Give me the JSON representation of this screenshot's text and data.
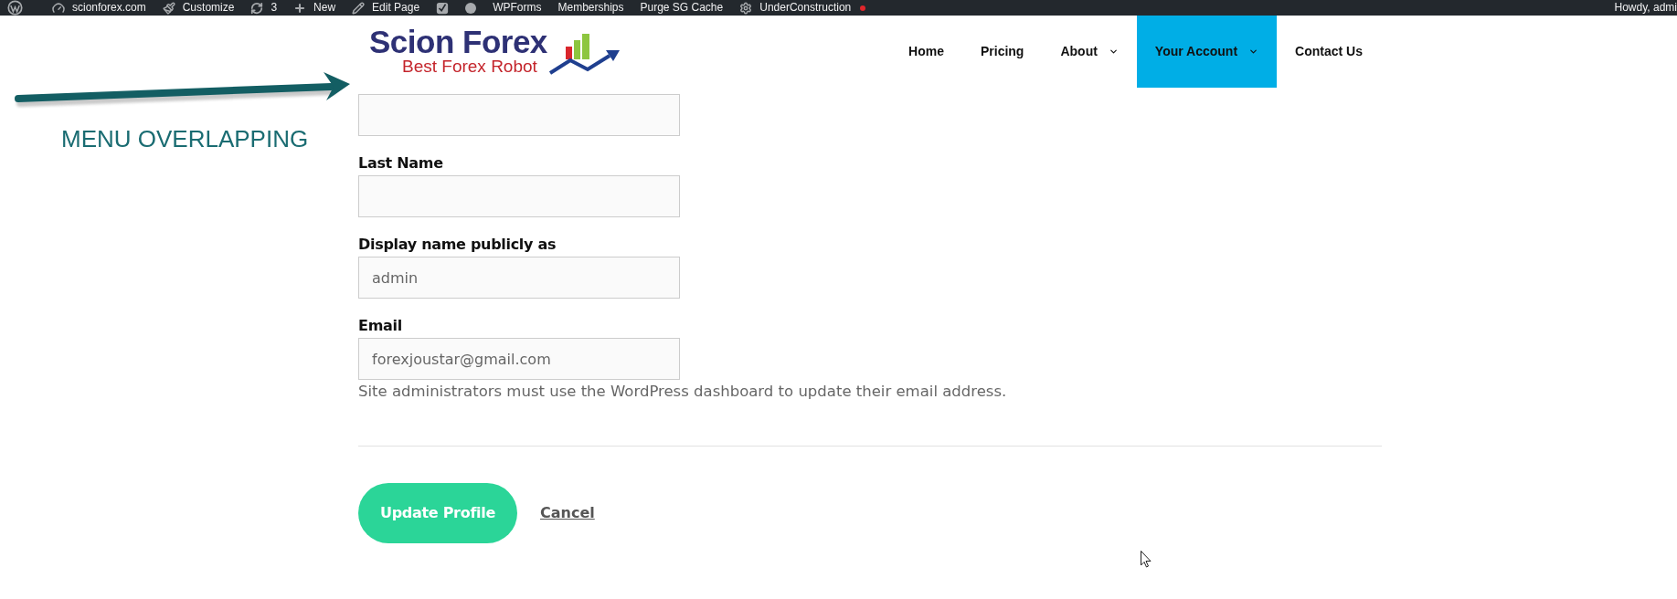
{
  "admin_bar": {
    "items": [
      {
        "kind": "logo"
      },
      {
        "kind": "site",
        "label": "scionforex.com"
      },
      {
        "kind": "customize",
        "label": "Customize"
      },
      {
        "kind": "updates",
        "label": "3"
      },
      {
        "kind": "new",
        "label": "New"
      },
      {
        "kind": "edit",
        "label": "Edit Page"
      },
      {
        "kind": "seo"
      },
      {
        "kind": "status"
      },
      {
        "kind": "text",
        "label": "WPForms"
      },
      {
        "kind": "text",
        "label": "Memberships"
      },
      {
        "kind": "text",
        "label": "Purge SG Cache"
      },
      {
        "kind": "maintenance",
        "label": "UnderConstruction"
      }
    ],
    "greeting": "Howdy, admi"
  },
  "header": {
    "logo": {
      "title": "Scion Forex",
      "tagline": "Best Forex Robot"
    },
    "nav": [
      {
        "label": "Home",
        "dropdown": false,
        "selected": false
      },
      {
        "label": "Pricing",
        "dropdown": false,
        "selected": false
      },
      {
        "label": "About",
        "dropdown": true,
        "selected": false
      },
      {
        "label": "Your Account",
        "dropdown": true,
        "selected": true
      },
      {
        "label": "Contact Us",
        "dropdown": false,
        "selected": false
      }
    ]
  },
  "annotation": {
    "label": "MENU OVERLAPPING"
  },
  "form": {
    "rows": [
      {
        "kind": "input"
      },
      {
        "kind": "label",
        "text": "Last Name"
      },
      {
        "kind": "input"
      },
      {
        "kind": "label",
        "text": "Display name publicly as"
      },
      {
        "kind": "input",
        "value": "admin"
      },
      {
        "kind": "label",
        "text": "Email"
      },
      {
        "kind": "input",
        "value": "forexjoustar@gmail.com"
      },
      {
        "kind": "help",
        "text": "Site administrators must use the WordPress dashboard to update their email address."
      }
    ],
    "buttons": [
      {
        "kind": "submit",
        "label": "Update Profile"
      },
      {
        "kind": "link",
        "label": "Cancel"
      }
    ]
  }
}
